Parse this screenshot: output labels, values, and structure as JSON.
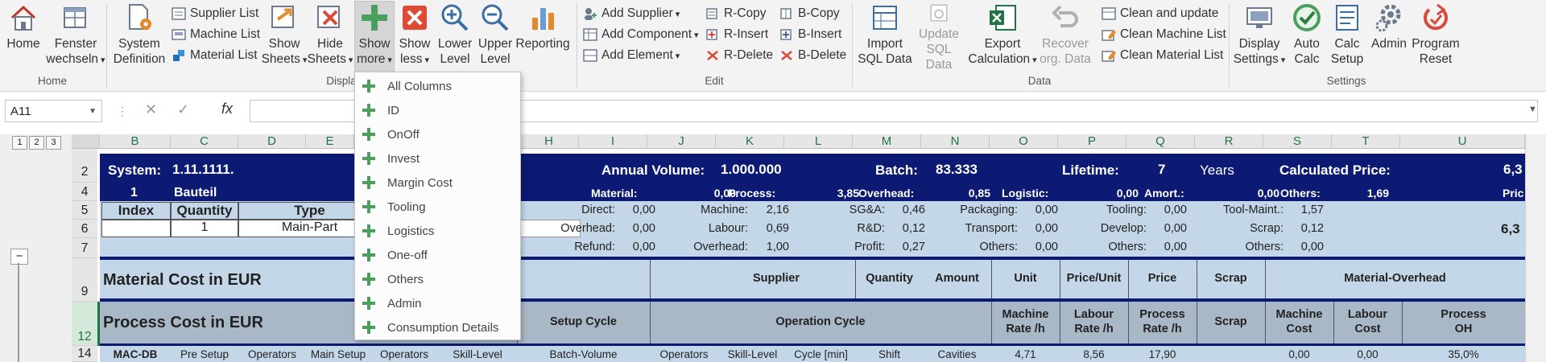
{
  "ribbon": {
    "home_group": {
      "home": "Home",
      "fenster_line1": "Fenster",
      "fenster_line2": "wechseln",
      "label": "Home"
    },
    "display_group": {
      "system_line1": "System",
      "system_line2": "Definition",
      "supplier_list": "Supplier List",
      "machine_list": "Machine List",
      "material_list": "Material List",
      "show_sheets_line1": "Show",
      "show_sheets_line2": "Sheets",
      "hide_sheets_line1": "Hide",
      "hide_sheets_line2": "Sheets",
      "show_more_line1": "Show",
      "show_more_line2": "more",
      "show_less_line1": "Show",
      "show_less_line2": "less",
      "lower_level_line1": "Lower",
      "lower_level_line2": "Level",
      "upper_level_line1": "Upper",
      "upper_level_line2": "Level",
      "reporting": "Reporting",
      "label": "Displa"
    },
    "edit_group": {
      "add_supplier": "Add Supplier",
      "add_component": "Add Component",
      "add_element": "Add Element",
      "r_copy": "R-Copy",
      "r_insert": "R-Insert",
      "r_delete": "R-Delete",
      "b_copy": "B-Copy",
      "b_insert": "B-Insert",
      "b_delete": "B-Delete",
      "label": "Edit"
    },
    "data_group": {
      "import_line1": "Import",
      "import_line2": "SQL Data",
      "update_line1": "Update",
      "update_line2": "SQL Data",
      "export_line1": "Export",
      "export_line2": "Calculation",
      "recover_line1": "Recover",
      "recover_line2": "org. Data",
      "clean_update": "Clean and update",
      "clean_machine": "Clean Machine List",
      "clean_material": "Clean Material List",
      "label": "Data"
    },
    "settings_group": {
      "display_line1": "Display",
      "display_line2": "Settings",
      "auto_line1": "Auto",
      "auto_line2": "Calc",
      "calc_line1": "Calc",
      "calc_line2": "Setup",
      "admin": "Admin",
      "program_line1": "Program",
      "program_line2": "Reset",
      "label": "Settings"
    }
  },
  "menu": {
    "items": [
      "All Columns",
      "ID",
      "OnOff",
      "Invest",
      "Margin Cost",
      "Tooling",
      "Logistics",
      "One-off",
      "Others",
      "Admin",
      "Consumption Details"
    ]
  },
  "formula_bar": {
    "name_box": "A11",
    "cancel": "✕",
    "enter": "✓",
    "fx": "fx",
    "value": ""
  },
  "grid": {
    "outline_levels": [
      "1",
      "2",
      "3"
    ],
    "collapse": "−",
    "columns": [
      "B",
      "C",
      "D",
      "E",
      "H",
      "I",
      "J",
      "K",
      "L",
      "M",
      "N",
      "O",
      "P",
      "Q",
      "R",
      "S",
      "T",
      "U"
    ],
    "rows": [
      "2",
      "4",
      "5",
      "6",
      "7",
      "9",
      "12",
      "14"
    ],
    "row2": {
      "system_label": "System:",
      "system_value": "1.11.1111.",
      "annual_label": "Annual Volume:",
      "annual_value": "1.000.000",
      "batch_label": "Batch:",
      "batch_value": "83.333",
      "lifetime_label": "Lifetime:",
      "lifetime_value": "7",
      "years": "Years",
      "calc_price_label": "Calculated Price:",
      "calc_price_value": "6,3"
    },
    "row4": {
      "num": "1",
      "bauteil": "Bauteil",
      "material_label": "Material:",
      "material_value": "0,00",
      "process_label": "Process:",
      "process_value": "3,85",
      "overhead_label": "Overhead:",
      "overhead_value": "0,85",
      "logistic_label": "Logistic:",
      "logistic_value": "0,00",
      "amort_label": "Amort.:",
      "amort_value": "0,00",
      "others_label": "Others:",
      "others_value": "1,69",
      "price_label": "Pric"
    },
    "row5": {
      "index": "Index",
      "quantity": "Quantity",
      "type": "Type",
      "direct_label": "Direct:",
      "direct_value": "0,00",
      "machine_label": "Machine:",
      "machine_value": "2,16",
      "sga_label": "SG&A:",
      "sga_value": "0,46",
      "packaging_label": "Packaging:",
      "packaging_value": "0,00",
      "tooling_label": "Tooling:",
      "tooling_value": "0,00",
      "toolmaint_label": "Tool-Maint.:",
      "toolmaint_value": "1,57"
    },
    "row6": {
      "quantity": "1",
      "type": "Main-Part",
      "overhead_label": "Overhead:",
      "overhead_value": "0,00",
      "labour_label": "Labour:",
      "labour_value": "0,69",
      "rd_label": "R&D:",
      "rd_value": "0,12",
      "transport_label": "Transport:",
      "transport_value": "0,00",
      "develop_label": "Develop:",
      "develop_value": "0,00",
      "scrap_label": "Scrap:",
      "scrap_value": "0,12",
      "price_value": "6,3"
    },
    "row7": {
      "refund_label": "Refund:",
      "refund_value": "0,00",
      "overhead_label": "Overhead:",
      "overhead_value": "1,00",
      "profit_label": "Profit:",
      "profit_value": "0,27",
      "others1_label": "Others:",
      "others1_value": "0,00",
      "others2_label": "Others:",
      "others2_value": "0,00",
      "others3_label": "Others:",
      "others3_value": "0,00"
    },
    "row9": {
      "title": "Material Cost in EUR",
      "supplier": "Supplier",
      "quantity": "Quantity",
      "amount": "Amount",
      "unit": "Unit",
      "price_unit": "Price/Unit",
      "price": "Price",
      "scrap": "Scrap",
      "material_overhead": "Material-Overhead"
    },
    "row12": {
      "title": "Process Cost in EUR",
      "setup_cycle": "Setup Cycle",
      "operation_cycle": "Operation Cycle",
      "machine_rate_1": "Machine",
      "machine_rate_2": "Rate /h",
      "labour_rate_1": "Labour",
      "labour_rate_2": "Rate /h",
      "process_rate_1": "Process",
      "process_rate_2": "Rate /h",
      "scrap": "Scrap",
      "machine_cost_1": "Machine",
      "machine_cost_2": "Cost",
      "labour_cost_1": "Labour",
      "labour_cost_2": "Cost",
      "process_oh_1": "Process",
      "process_oh_2": "OH"
    },
    "row14": {
      "c1": "MAC-DB",
      "c2": "Pre Setup",
      "c3": "Operators",
      "c4": "Main Setup",
      "c5": "Operators",
      "c6": "Skill-Level",
      "c7": "Batch-Volume",
      "c8": "Operators",
      "c9": "Skill-Level",
      "c10": "Cycle [min]",
      "c11": "Shift",
      "c12": "Cavities",
      "c13": "4,71",
      "c14": "8,56",
      "c15": "17,90",
      "c16": "0,00",
      "c17": "0,00",
      "c18": "35,0%"
    }
  }
}
